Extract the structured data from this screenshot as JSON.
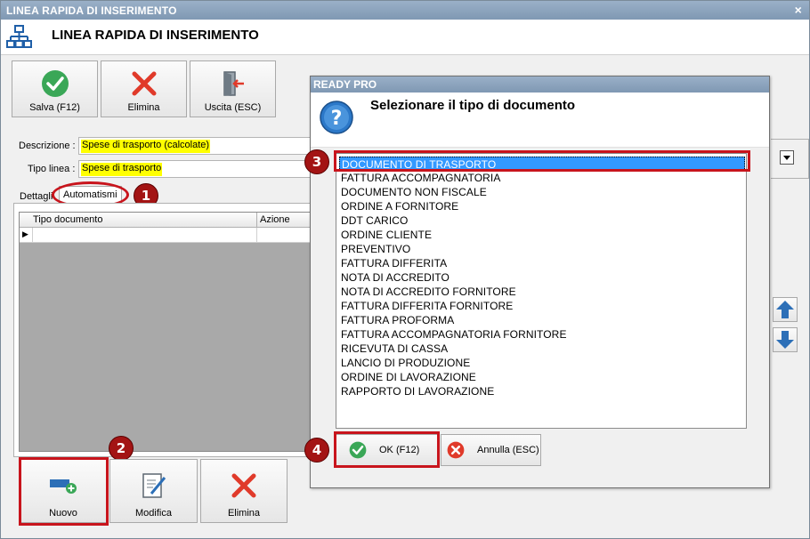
{
  "window": {
    "title": "LINEA RAPIDA DI INSERIMENTO",
    "close": "×",
    "header_title": "LINEA RAPIDA DI INSERIMENTO"
  },
  "toolbar": {
    "save_label": "Salva (F12)",
    "delete_label": "Elimina",
    "exit_label": "Uscita (ESC)"
  },
  "form": {
    "descrizione_label": "Descrizione :",
    "descrizione_value": "Spese di trasporto (calcolate)",
    "tipo_linea_label": "Tipo linea :",
    "tipo_linea_value": "Spese di trasporto"
  },
  "tabs": {
    "details": "Dettagli",
    "automations": "Automatismi"
  },
  "grid": {
    "col_tipo": "Tipo documento",
    "col_azione": "Azione",
    "row_marker": "▶"
  },
  "bottom_toolbar": {
    "new_label": "Nuovo",
    "edit_label": "Modifica",
    "delete_label": "Elimina"
  },
  "badges": {
    "b1": "1",
    "b2": "2",
    "b3": "3",
    "b4": "4"
  },
  "dialog": {
    "title": "READY PRO",
    "message": "Selezionare il tipo di documento",
    "items": [
      "DOCUMENTO DI TRASPORTO",
      "FATTURA ACCOMPAGNATORIA",
      "DOCUMENTO NON FISCALE",
      "ORDINE A FORNITORE",
      "DDT CARICO",
      "ORDINE CLIENTE",
      "PREVENTIVO",
      "FATTURA DIFFERITA",
      "NOTA DI ACCREDITO",
      "NOTA DI ACCREDITO FORNITORE",
      "FATTURA DIFFERITA FORNITORE",
      "FATTURA PROFORMA",
      "FATTURA ACCOMPAGNATORIA FORNITORE",
      "RICEVUTA DI CASSA",
      "LANCIO DI PRODUZIONE",
      "ORDINE DI LAVORAZIONE",
      "RAPPORTO DI LAVORAZIONE"
    ],
    "selected_index": 0,
    "ok_label": "OK (F12)",
    "cancel_label": "Annulla (ESC)"
  },
  "colors": {
    "accent_red": "#c8141c",
    "selection_blue": "#3399ff",
    "highlight_yellow": "#ffff00",
    "ok_green": "#3aa757"
  },
  "icons": [
    "window-icon",
    "check-icon",
    "x-icon",
    "exit-door-icon",
    "new-item-icon",
    "edit-icon",
    "question-icon",
    "arrow-up-icon",
    "arrow-down-icon",
    "dropdown-icon"
  ]
}
